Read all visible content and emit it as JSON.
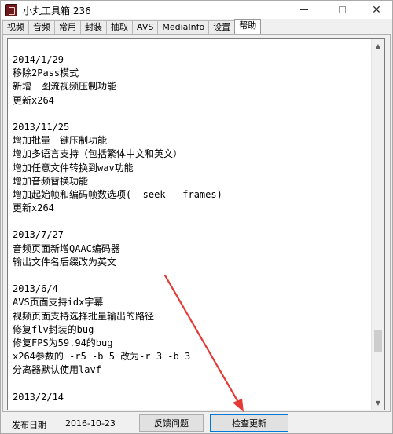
{
  "window": {
    "title": "小丸工具箱 236",
    "minimize_glyph": "",
    "close_glyph": "✕"
  },
  "tabs": [
    {
      "label": "视频"
    },
    {
      "label": "音频"
    },
    {
      "label": "常用"
    },
    {
      "label": "封装"
    },
    {
      "label": "抽取"
    },
    {
      "label": "AVS"
    },
    {
      "label": "MediaInfo"
    },
    {
      "label": "设置"
    },
    {
      "label": "帮助",
      "active": true
    }
  ],
  "changelog": {
    "lines": [
      "2014/1/29",
      "移除2Pass模式",
      "新增一图流视频压制功能",
      "更新x264",
      "",
      "2013/11/25",
      "增加批量一键压制功能",
      "增加多语言支持（包括繁体中文和英文）",
      "增加任意文件转换到wav功能",
      "增加音频替换功能",
      "增加起始帧和编码帧数选项(--seek --frames)",
      "更新x264",
      "",
      "2013/7/27",
      "音频页面新增QAAC编码器",
      "输出文件名后缀改为英文",
      "",
      "2013/6/4",
      "AVS页面支持idx字幕",
      "视频页面支持选择批量输出的路径",
      "修复flv封装的bug",
      "修复FPS为59.94的bug",
      "x264参数的 -r5 -b 5 改为-r 3 -b 3",
      "分离器默认使用lavf",
      "",
      "2013/2/14"
    ]
  },
  "scrollbar": {
    "position": 0.86
  },
  "footer": {
    "release_label": "发布日期",
    "release_date": "2016-10-23",
    "feedback_button": "反馈问题",
    "check_update_button": "检查更新"
  },
  "annotation": {
    "arrow_color": "#e53935"
  }
}
